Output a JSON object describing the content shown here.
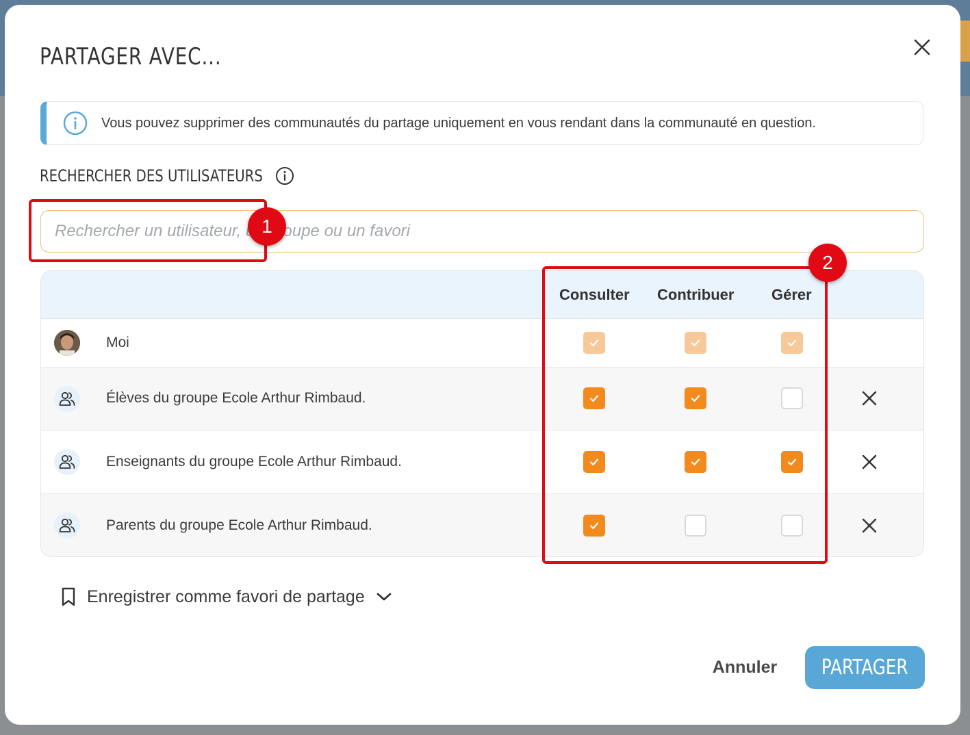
{
  "dialog": {
    "title": "PARTAGER AVEC...",
    "info_text": "Vous pouvez supprimer des communautés du partage uniquement en vous rendant dans la communauté en question.",
    "search_label": "RECHERCHER DES UTILISATEURS",
    "search_placeholder": "Rechercher un utilisateur, un groupe ou un favori",
    "search_value": ""
  },
  "table": {
    "columns": [
      "Consulter",
      "Contribuer",
      "Gérer"
    ],
    "rows": [
      {
        "name": "Moi",
        "type": "user",
        "rights": [
          "dimmed",
          "dimmed",
          "dimmed"
        ],
        "removable": false
      },
      {
        "name": "Élèves du groupe Ecole Arthur Rimbaud.",
        "type": "group",
        "rights": [
          "checked",
          "checked",
          "unchecked"
        ],
        "removable": true
      },
      {
        "name": "Enseignants du groupe Ecole Arthur Rimbaud.",
        "type": "group",
        "rights": [
          "checked",
          "checked",
          "checked"
        ],
        "removable": true
      },
      {
        "name": "Parents du groupe Ecole Arthur Rimbaud.",
        "type": "group",
        "rights": [
          "checked",
          "unchecked",
          "unchecked"
        ],
        "removable": true
      }
    ]
  },
  "favorite": {
    "label": "Enregistrer comme favori de partage"
  },
  "footer": {
    "cancel_label": "Annuler",
    "share_label": "PARTAGER"
  },
  "annotations": {
    "one": "1",
    "two": "2"
  },
  "colors": {
    "accent": "#f28a1e",
    "primary": "#58a7d6",
    "annotation": "#e10a14",
    "header_bg": "#e9f4fd"
  },
  "icons": {
    "close": "close-icon",
    "info": "info-icon",
    "group": "group-icon",
    "remove": "remove-icon",
    "bookmark": "bookmark-icon",
    "chevron": "chevron-down-icon",
    "check": "check-icon"
  }
}
